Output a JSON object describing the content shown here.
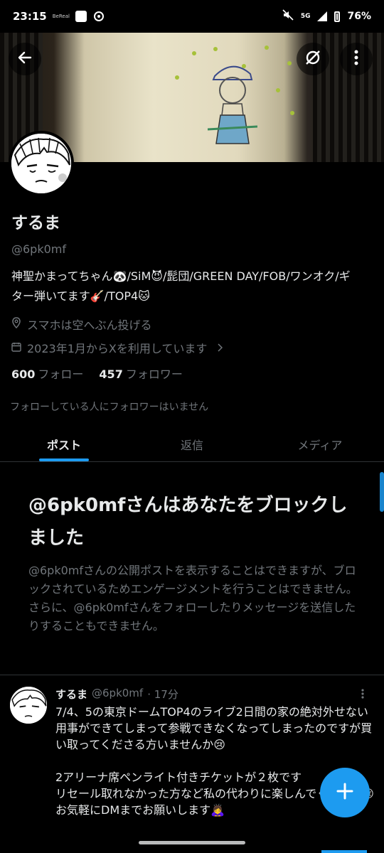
{
  "status_bar": {
    "time": "23:15",
    "bereal": "BeReal",
    "network": "5G",
    "battery": "76%"
  },
  "profile": {
    "display_name": "するま",
    "handle": "@6pk0mf",
    "bio_line1": "神聖かまってちゃん🐼/SiM😈/髭団/GREEN DAY/FOB/ワンオク/ギ",
    "bio_line2": "ター弾いてます🎸/TOP4🐱",
    "location": "スマホは空へぶん投げる",
    "joined": "2023年1月からXを利用しています",
    "following_count": "600",
    "following_label": "フォロー",
    "followers_count": "457",
    "followers_label": "フォロワー",
    "no_mutual_text": "フォローしている人にフォロワーはいません"
  },
  "tabs": [
    {
      "label": "ポスト",
      "active": true
    },
    {
      "label": "返信",
      "active": false
    },
    {
      "label": "メディア",
      "active": false
    }
  ],
  "blocked": {
    "title": "@6pk0mfさんはあなたをブロックしました",
    "body": "@6pk0mfさんの公開ポストを表示することはできますが、ブロックされているためエンゲージメントを行うことはできません。さらに、@6pk0mfさんをフォローしたりメッセージを送信したりすることもできません。"
  },
  "post": {
    "name": "するま",
    "handle": "@6pk0mf",
    "time": "· 17分",
    "text": "7/4、5の東京ドームTOP4のライブ2日間の家の絶対外せない用事ができてしまって参戦できなくなってしまったのですが買い取ってくださる方いませんか😢\n\n2アリーナ席ペンライト付きチケットが２枚です\nリセール取れなかった方など私の代わりに楽しんでください😢\nお気軽にDMまでお願いします🙇‍♀️"
  },
  "icons": {
    "back": "back-arrow-icon",
    "grok": "grok-icon",
    "more": "more-vertical-icon",
    "location": "location-pin-icon",
    "calendar": "calendar-icon",
    "compose": "plus-icon"
  },
  "colors": {
    "accent": "#1d9bf0",
    "background": "#000000",
    "text_primary": "#e7e9ea",
    "text_secondary": "#71767b"
  }
}
